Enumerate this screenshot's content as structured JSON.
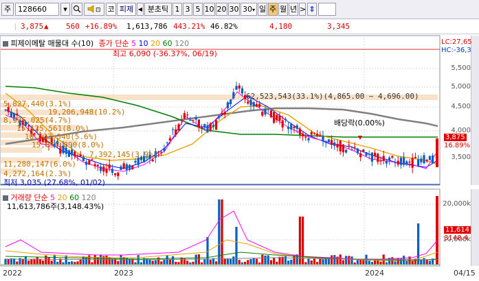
{
  "toolbar": {
    "market": "주",
    "code": "128660",
    "search_icon": "search-icon",
    "sound_icon": "speaker-icon",
    "tab_ko": "코",
    "stock_name": "피제",
    "prev_arrow": "◀",
    "timeframe_label": "분초틱",
    "periods": [
      "1",
      "3",
      "5",
      "10",
      "20",
      "30"
    ],
    "period_select": "30",
    "day": "일",
    "week": "주",
    "month": "월",
    "year": "년",
    "next_arrow": ">",
    "updown_icon": "updown-arrow-icon"
  },
  "quote": {
    "price": "3,875",
    "arrow": "▲",
    "change": "560",
    "change_pct": "+16.89%",
    "volume": "1,613,786",
    "volume_ratio": "443.21%",
    "turnover": "46.82%",
    "high": "4,180",
    "low": "3,345"
  },
  "price_panel": {
    "title": "피제이메탈 매물대 수(10)",
    "ma_label": "종가 단순",
    "ma_periods": [
      "5",
      "10",
      "20",
      "60",
      "120"
    ],
    "ma_colors": [
      "#ff00ff",
      "#0000ff",
      "#e8a000",
      "#008000",
      "#808080"
    ],
    "high_label": "최고 6,090 (-36.37%, 06/19)",
    "low_label": "최저 3,035 (27.68%, 01/02)",
    "lc_label": "LC:27,65",
    "hc_label": "HC:-36,3",
    "dividend_label": "배당락(0.00%)",
    "vp_top": "62,523,543(33.1%)(4,865.00 ~ 4,696.00)",
    "vp_labels": [
      "5,827,440(3.1%)",
      "19,206,948(10.2%)",
      "8,925,025(4.7%)",
      "15,125,561(8.0%)",
      "10,533,540(5.6%)",
      "15,050,890(8.0%)",
      "7,392,145(3.9%)",
      "11,280,147(6.0%)",
      "4,272,164(2.3%)"
    ],
    "price_ticks": [
      "5,500",
      "5,000",
      "4,500",
      "4,000",
      "3,500"
    ],
    "current_price_box": "3,875",
    "current_pct_box": "16.89%"
  },
  "volume_panel": {
    "title": "거래량 단순",
    "ma_periods": [
      "5",
      "20",
      "60",
      "120"
    ],
    "ma_colors": [
      "#ff00ff",
      "#e8a000",
      "#008000",
      "#808080"
    ],
    "summary": "11,613,786주(3,148.43%)",
    "ticks": [
      "20,000k",
      "10,000k"
    ],
    "current_box": "11,614",
    "current_pct": "3148.4"
  },
  "x_axis": [
    "2022",
    "2023",
    "2024",
    "04/15"
  ]
}
